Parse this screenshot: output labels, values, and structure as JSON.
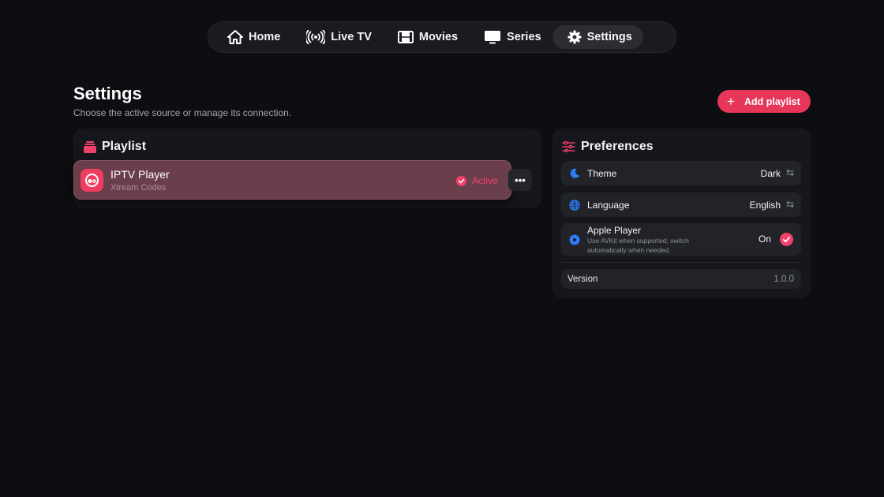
{
  "nav": {
    "items": [
      {
        "label": "Home",
        "icon": "home-icon"
      },
      {
        "label": "Live TV",
        "icon": "broadcast-icon"
      },
      {
        "label": "Movies",
        "icon": "film-icon"
      },
      {
        "label": "Series",
        "icon": "tv-icon"
      },
      {
        "label": "Settings",
        "icon": "gear-icon",
        "active": true
      }
    ]
  },
  "header": {
    "title": "Settings",
    "subtitle": "Choose the active source or manage its connection.",
    "add_button": {
      "icon": "+",
      "label": "Add playlist"
    }
  },
  "playlist": {
    "title": "Playlist",
    "items": [
      {
        "name": "IPTV Player",
        "type": "Xtream Codes",
        "status": "Active",
        "more": "•••"
      }
    ]
  },
  "preferences": {
    "title": "Preferences",
    "theme": {
      "label": "Theme",
      "value": "Dark",
      "swap": "⇆"
    },
    "language": {
      "label": "Language",
      "value": "English",
      "swap": "⇆"
    },
    "apple_player": {
      "label": "Apple Player",
      "description": "Use AVKit when supported; switch automatically when needed.",
      "value": "On"
    },
    "version": {
      "label": "Version",
      "value": "1.0.0"
    }
  },
  "colors": {
    "accent": "#e63659",
    "background": "#0d0e12",
    "card": "#15171c",
    "active_row": "#6a3e4a",
    "info_blue": "#2f7cf6"
  }
}
